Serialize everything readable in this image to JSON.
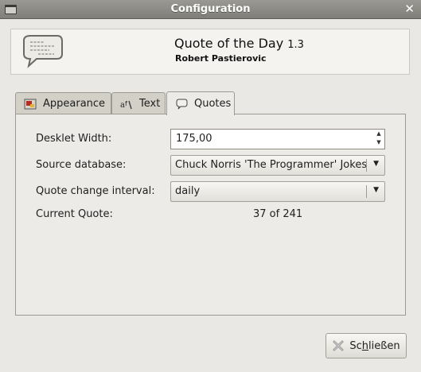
{
  "window": {
    "title": "Configuration",
    "close_glyph": "✕"
  },
  "header": {
    "app_name": "Quote of the Day",
    "version": "1.3",
    "author": "Robert Pastierovic",
    "logo_icon": "speech-bubble-quote-icon"
  },
  "tabs": [
    {
      "label": "Appearance",
      "icon": "appearance-icon",
      "active": false
    },
    {
      "label": "Text",
      "icon": "text-font-icon",
      "active": false
    },
    {
      "label": "Quotes",
      "icon": "speech-bubble-icon",
      "active": true
    }
  ],
  "form": {
    "desklet_width": {
      "label": "Desklet Width:",
      "value": "175,00"
    },
    "source_database": {
      "label": "Source database:",
      "value": "Chuck Norris 'The Programmer' Jokes"
    },
    "interval": {
      "label": "Quote change interval:",
      "value": "daily"
    },
    "current_quote": {
      "label": "Current Quote:",
      "value": "37 of 241"
    }
  },
  "footer": {
    "close_label_prefix": "Sc",
    "close_label_mnemonic": "h",
    "close_label_suffix": "ließen"
  },
  "colors": {
    "titlebar": "#8c8b85",
    "window_bg": "#e9e8e4",
    "close_icon": "#9a9a9a"
  }
}
